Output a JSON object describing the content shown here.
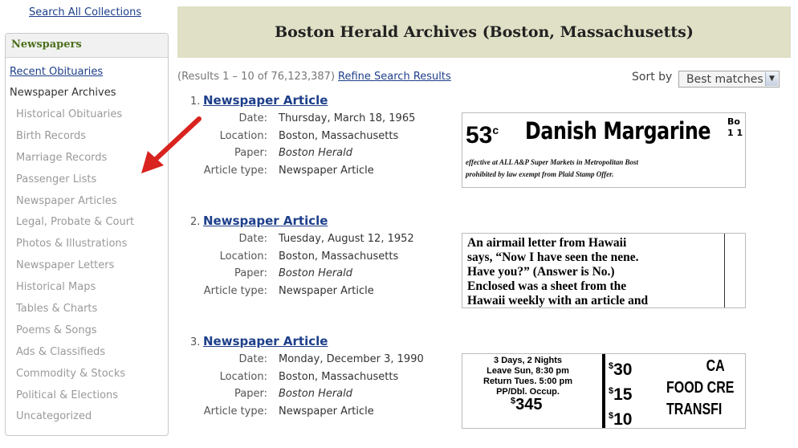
{
  "search_all_label": "Search All Collections",
  "sidebar": {
    "heading": "Newspapers",
    "recent_obituaries": "Recent Obituaries",
    "active": "Newspaper Archives",
    "categories": [
      "Historical Obituaries",
      "Birth Records",
      "Marriage Records",
      "Passenger Lists",
      "Newspaper Articles",
      "Legal, Probate & Court",
      "Photos & Illustrations",
      "Newspaper Letters",
      "Historical Maps",
      "Tables & Charts",
      "Poems & Songs",
      "Ads & Classifieds",
      "Commodity & Stocks",
      "Political & Elections",
      "Uncategorized"
    ]
  },
  "header": {
    "title": "Boston Herald Archives (Boston, Massachusetts)"
  },
  "results_info": {
    "text": "(Results 1 – 10 of 76,123,387)",
    "refine_label": "Refine Search Results"
  },
  "sort": {
    "label": "Sort by",
    "selected": "Best matches"
  },
  "meta_labels": {
    "date": "Date:",
    "location": "Location:",
    "paper": "Paper:",
    "type": "Article type:"
  },
  "results": [
    {
      "num": "1.",
      "title": "Newspaper Article",
      "date": "Thursday, March 18, 1965",
      "location": "Boston, Massachusetts",
      "paper": "Boston Herald",
      "type": "Newspaper Article",
      "clip": {
        "price": "53",
        "cents": "c",
        "headline": "Danish Margarine",
        "edge": "Bo",
        "edge2": "1 1",
        "line1": "effective at ALL A&P Super Markets in Metropolitan Bost",
        "line2": "prohibited by law exempt from Plaid Stamp Offer."
      }
    },
    {
      "num": "2.",
      "title": "Newspaper Article",
      "date": "Tuesday, August 12, 1952",
      "location": "Boston, Massachusetts",
      "paper": "Boston Herald",
      "type": "Newspaper Article",
      "clip": {
        "lines": [
          "An airmail letter from Hawaii",
          "says, “Now I have seen the nene.",
          "Have you?” (Answer is No.)",
          "Enclosed was a sheet from the",
          "Hawaii weekly with an article and"
        ]
      }
    },
    {
      "num": "3.",
      "title": "Newspaper Article",
      "date": "Monday, December 3, 1990",
      "location": "Boston, Massachusetts",
      "paper": "Boston Herald",
      "type": "Newspaper Article",
      "clip": {
        "left": [
          "3 Days, 2 Nights",
          "Leave Sun, 8:30 pm",
          "Return Tues. 5:00 pm",
          "PP/Dbl. Occup."
        ],
        "big_price": "345",
        "prices": [
          "30",
          "15",
          "10"
        ],
        "right": [
          "CA",
          "FOOD CRE",
          "TRANSFI"
        ]
      }
    }
  ]
}
